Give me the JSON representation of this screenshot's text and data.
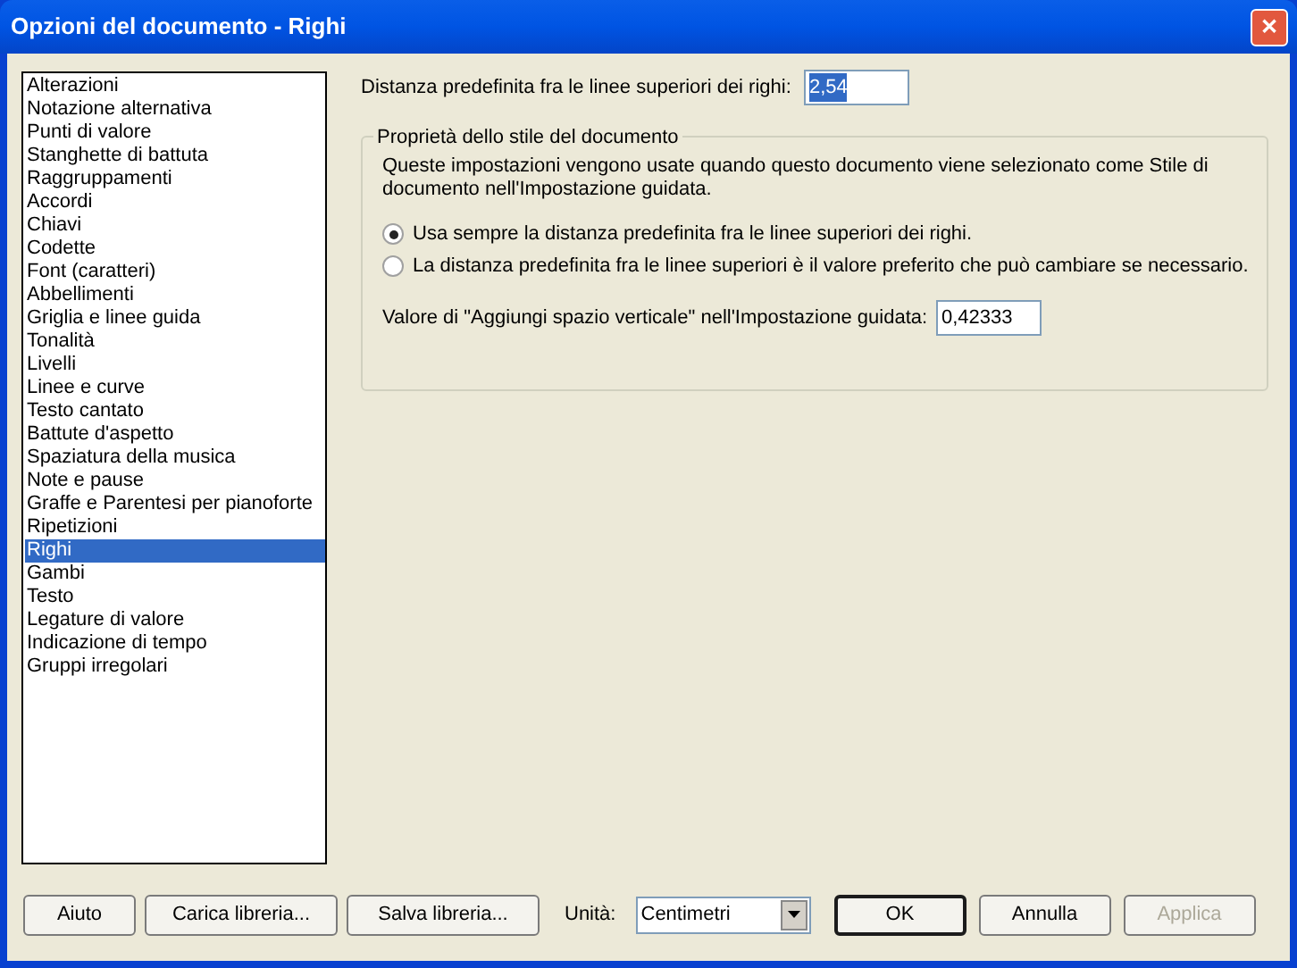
{
  "window": {
    "title": "Opzioni del documento - Righi",
    "close": "✕"
  },
  "sidebar": {
    "items": [
      {
        "label": "Alterazioni",
        "selected": false
      },
      {
        "label": "Notazione alternativa",
        "selected": false
      },
      {
        "label": "Punti di valore",
        "selected": false
      },
      {
        "label": "Stanghette di battuta",
        "selected": false
      },
      {
        "label": "Raggruppamenti",
        "selected": false
      },
      {
        "label": "Accordi",
        "selected": false
      },
      {
        "label": "Chiavi",
        "selected": false
      },
      {
        "label": "Codette",
        "selected": false
      },
      {
        "label": "Font (caratteri)",
        "selected": false
      },
      {
        "label": "Abbellimenti",
        "selected": false
      },
      {
        "label": "Griglia e linee guida",
        "selected": false
      },
      {
        "label": "Tonalità",
        "selected": false
      },
      {
        "label": "Livelli",
        "selected": false
      },
      {
        "label": "Linee e curve",
        "selected": false
      },
      {
        "label": "Testo cantato",
        "selected": false
      },
      {
        "label": "Battute d'aspetto",
        "selected": false
      },
      {
        "label": "Spaziatura della musica",
        "selected": false
      },
      {
        "label": "Note e pause",
        "selected": false
      },
      {
        "label": "Graffe e Parentesi per pianoforte",
        "selected": false
      },
      {
        "label": "Ripetizioni",
        "selected": false
      },
      {
        "label": "Righi",
        "selected": true
      },
      {
        "label": "Gambi",
        "selected": false
      },
      {
        "label": "Testo",
        "selected": false
      },
      {
        "label": "Legature di valore",
        "selected": false
      },
      {
        "label": "Indicazione di tempo",
        "selected": false
      },
      {
        "label": "Gruppi irregolari",
        "selected": false
      }
    ]
  },
  "distance": {
    "label": "Distanza predefinita fra le linee superiori dei righi:",
    "value": "2,54"
  },
  "group": {
    "title": "Proprietà dello stile del documento",
    "description": "Queste impostazioni vengono usate quando questo documento viene selezionato come Stile di documento nell'Impostazione guidata.",
    "options": [
      {
        "label": "Usa sempre la distanza predefinita fra le linee superiori dei righi.",
        "selected": true
      },
      {
        "label": "La distanza predefinita fra le linee superiori è il valore preferito che può cambiare se necessario.",
        "selected": false
      }
    ],
    "spacing": {
      "label": "Valore di \"Aggiungi spazio verticale\" nell'Impostazione guidata:",
      "value": "0,42333"
    }
  },
  "footer": {
    "buttons": [
      {
        "label": "Aiuto",
        "disabled": false
      },
      {
        "label": "Carica libreria...",
        "disabled": false
      },
      {
        "label": "Salva libreria...",
        "disabled": false
      }
    ],
    "units": {
      "label": "Unità:",
      "value": "Centimetri"
    },
    "actions": [
      {
        "label": "OK",
        "disabled": false,
        "default": true
      },
      {
        "label": "Annulla",
        "disabled": false,
        "default": false
      },
      {
        "label": "Applica",
        "disabled": true,
        "default": false
      }
    ]
  }
}
